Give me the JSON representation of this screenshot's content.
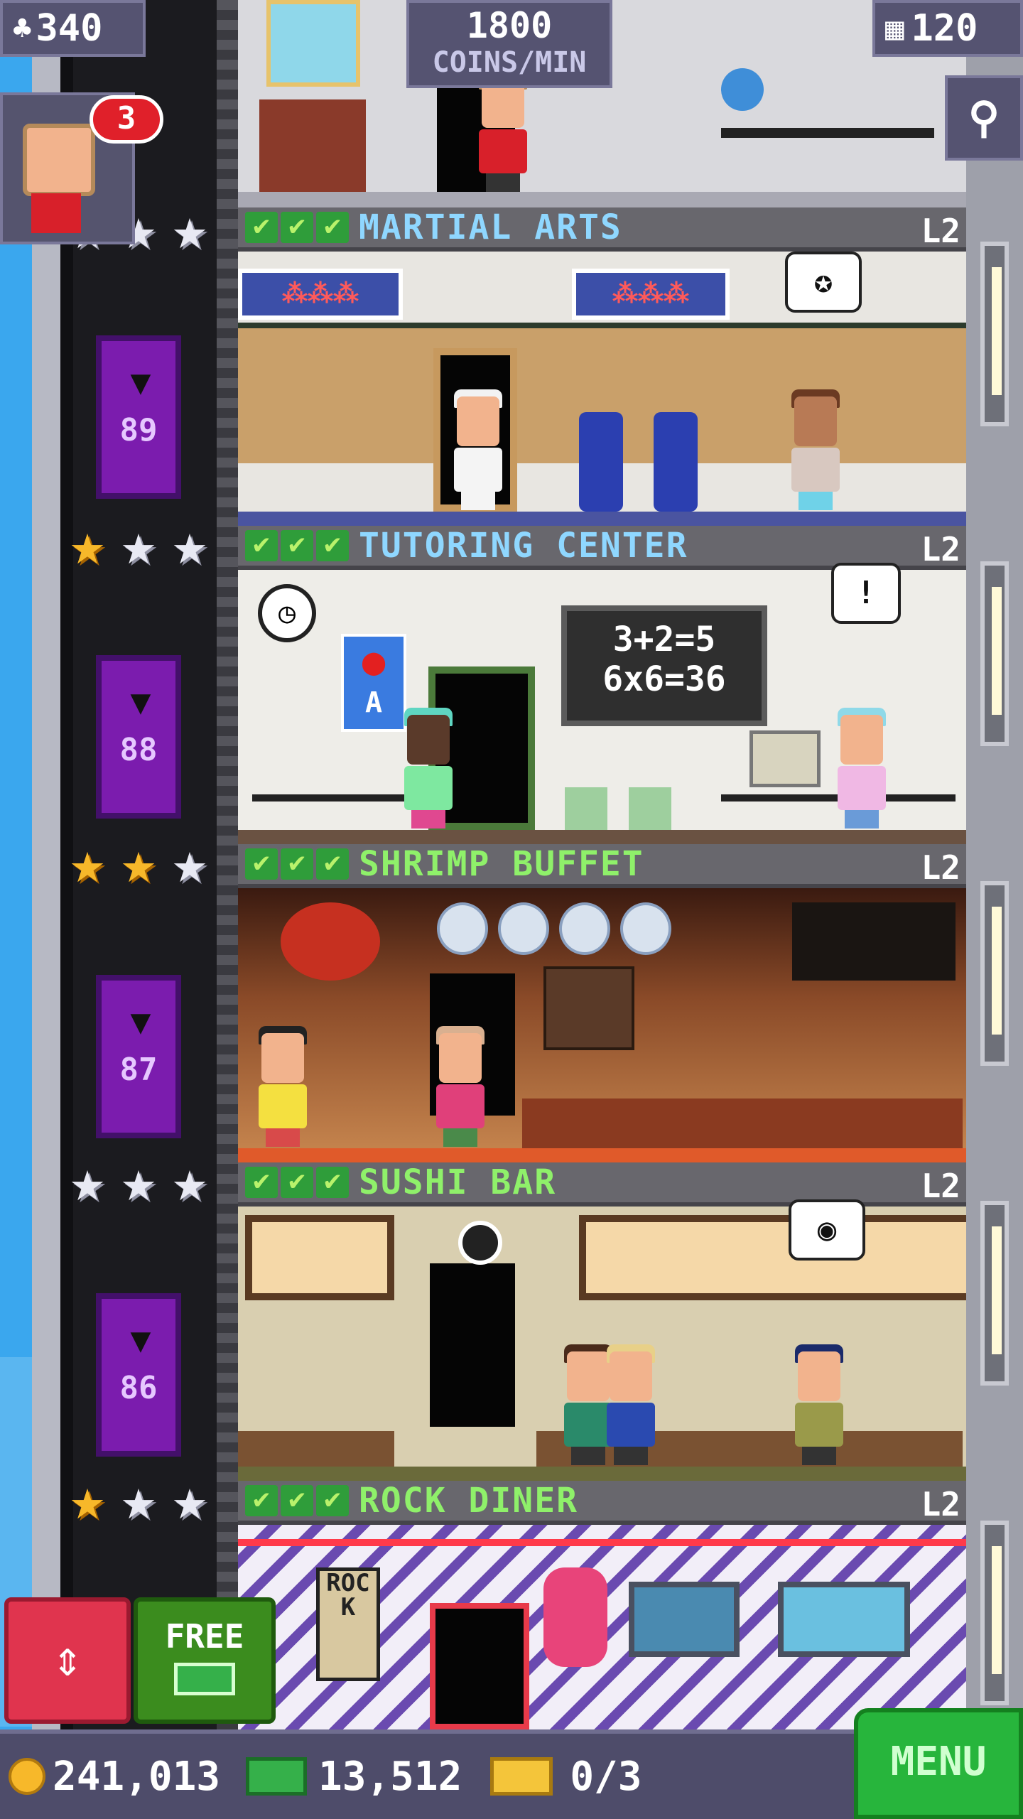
{
  "hud": {
    "population": "340",
    "coins_rate_value": "1800",
    "coins_rate_unit": "COINS/MIN",
    "floors_count": "120",
    "notification_count": "3"
  },
  "floors": [
    {
      "name": "MARTIAL ARTS",
      "level": "L2",
      "stars_gold": 1,
      "color": "#8fd7ff",
      "elevator_floor": "89"
    },
    {
      "name": "TUTORING CENTER",
      "level": "L2",
      "stars_gold": 1,
      "color": "#8fd7ff",
      "elevator_floor": "88"
    },
    {
      "name": "SHRIMP BUFFET",
      "level": "L2",
      "stars_gold": 2,
      "color": "#8ff06a",
      "elevator_floor": "87"
    },
    {
      "name": "SUSHI BAR",
      "level": "L2",
      "stars_gold": 0,
      "color": "#8ff06a",
      "elevator_floor": "86"
    },
    {
      "name": "ROCK DINER",
      "level": "L2",
      "stars_gold": 1,
      "color": "#8ff06a"
    }
  ],
  "room_text": {
    "chalkboard_line1": "3+2=5",
    "chalkboard_line2": "6x6=36",
    "poster_letter": "A",
    "rock_sign": "ROCK"
  },
  "bubbles": {
    "tutoring": "!"
  },
  "buttons": {
    "free_label": "FREE",
    "menu_label": "MENU"
  },
  "status": {
    "coins": "241,013",
    "bux": "13,512",
    "tickets": "0/3"
  },
  "colors": {
    "elevator_button": "#e0344e",
    "free_button": "#3b8c1e",
    "menu_button": "#27b53c",
    "hud_panel": "#555371"
  }
}
